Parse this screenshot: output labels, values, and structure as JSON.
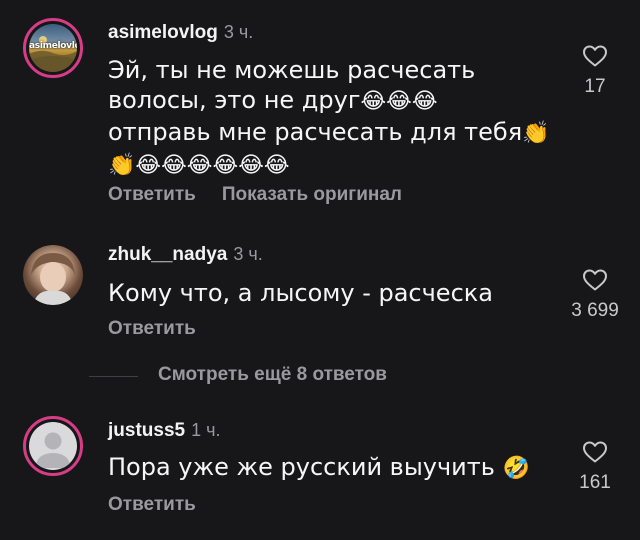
{
  "comments": [
    {
      "username": "asimelovlog",
      "time": "3 ч.",
      "avatar_text": "asimelovlog",
      "text_lines": [
        "Эй, ты не можешь расчесать",
        "волосы, это не друг",
        "отправь мне расчесать для тебя",
        ""
      ],
      "emoji_lines": [
        "",
        "😂😂😂",
        "👏",
        "👏😂😂😂😂😂😂"
      ],
      "likes": "17",
      "actions": [
        "Ответить",
        "Показать оригинал"
      ]
    },
    {
      "username": "zhuk__nadya",
      "time": "3 ч.",
      "text": "Кому что, а лысому - расческа",
      "likes": "3 699",
      "actions": [
        "Ответить"
      ]
    },
    {
      "username": "justuss5",
      "time": "1 ч.",
      "text": "Пора уже же русский выучить",
      "text_emoji": "🤣",
      "likes": "161",
      "actions": [
        "Ответить"
      ]
    }
  ],
  "more_replies": "Смотреть ещё 8 ответов",
  "icons": {
    "like": "heart-outline-icon",
    "default_avatar": "user-silhouette-icon"
  },
  "colors": {
    "background": "#17171a",
    "avatar_ring": "#d63d86",
    "secondary_text": "#9a9a9e"
  }
}
